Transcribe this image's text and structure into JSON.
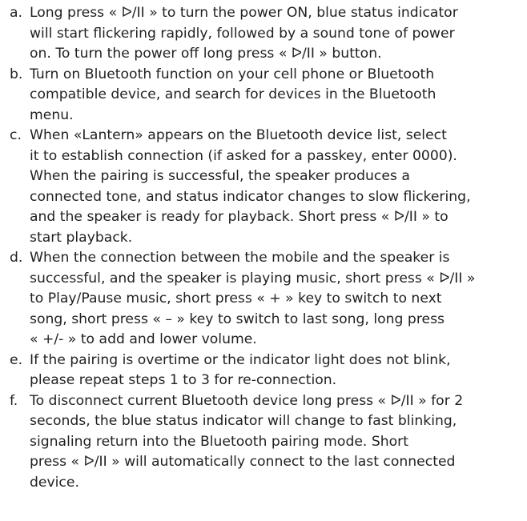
{
  "instructions": [
    {
      "marker": "a.",
      "text": "Long press « ᐅ/II » to turn the power ON, blue status indicator\nwill start flickering rapidly, followed by a sound tone of power\non. To turn the power off long press « ᐅ/II » button."
    },
    {
      "marker": "b.",
      "text": "Turn on Bluetooth function on your cell phone or Bluetooth\ncompatible device, and search for devices in the Bluetooth\nmenu."
    },
    {
      "marker": "c.",
      "text": "When «Lantern» appears on the Bluetooth device list, select\nit to establish connection (if asked for a passkey, enter 0000).\nWhen the pairing is successful, the speaker produces a\nconnected tone, and status indicator changes to slow flickering,\nand the speaker is ready for playback. Short press « ᐅ/II » to\nstart playback."
    },
    {
      "marker": "d.",
      "text": "When the connection between the mobile and the speaker is\nsuccessful, and the speaker is playing music, short press « ᐅ/II »\nto Play/Pause music, short press « + » key to switch to next\nsong,  short press « – » key to switch to last song, long press\n« +/- » to add and lower volume."
    },
    {
      "marker": "e.",
      "text": "If the pairing is overtime or the indicator light does not blink,\nplease repeat steps 1 to 3 for re-connection."
    },
    {
      "marker": "f.",
      "text": "To disconnect current Bluetooth device long press « ᐅ/II » for 2\nseconds, the blue status indicator will change to fast blinking,\nsignaling return into the Bluetooth pairing mode. Short\npress « ᐅ/II » will automatically connect to the last connected\ndevice."
    }
  ]
}
